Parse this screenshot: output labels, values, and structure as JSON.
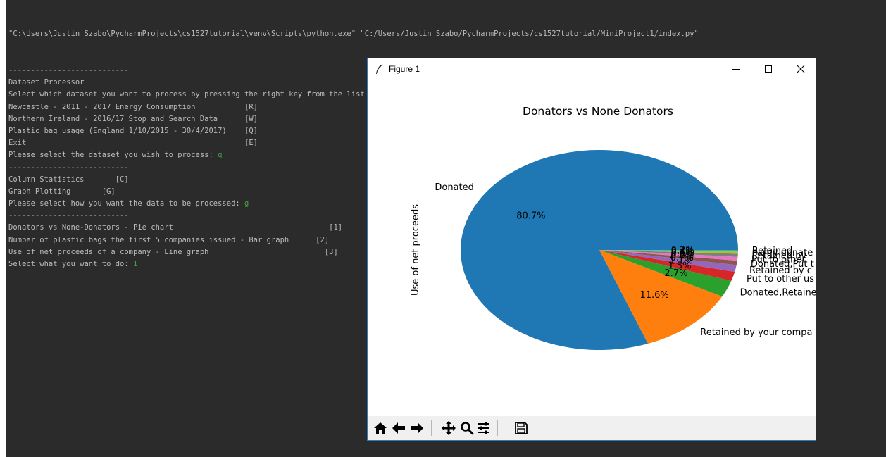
{
  "console": {
    "command_exe": "\"C:\\Users\\Justin Szabo\\PycharmProjects\\cs1527tutorial\\venv\\Scripts\\python.exe\"",
    "command_script": "\"C:/Users/Justin Szabo/PycharmProjects/cs1527tutorial/MiniProject1/index.py\"",
    "lines": [
      {
        "text": "---------------------------",
        "input": ""
      },
      {
        "text": "Dataset Processor",
        "input": ""
      },
      {
        "text": "Select which dataset you want to process by pressing the right key from the list below",
        "input": ""
      },
      {
        "text": "Newcastle - 2011 - 2017 Energy Consumption           [R]",
        "input": ""
      },
      {
        "text": "Northern Ireland - 2016/17 Stop and Search Data      [W]",
        "input": ""
      },
      {
        "text": "Plastic bag usage (England 1/10/2015 - 30/4/2017)    [Q]",
        "input": ""
      },
      {
        "text": "Exit                                                 [E]",
        "input": ""
      },
      {
        "text": "Please select the dataset you wish to process: ",
        "input": "q"
      },
      {
        "text": "---------------------------",
        "input": ""
      },
      {
        "text": "Column Statistics       [C]",
        "input": ""
      },
      {
        "text": "Graph Plotting       [G]",
        "input": ""
      },
      {
        "text": "Please select how you want the data to be processed: ",
        "input": "g"
      },
      {
        "text": "---------------------------",
        "input": ""
      },
      {
        "text": "Donators vs None-Donators - Pie chart                                   [1]",
        "input": ""
      },
      {
        "text": "Number of plastic bags the first 5 companies issued - Bar graph      [2]",
        "input": ""
      },
      {
        "text": "Use of net proceeds of a company - Line graph                          [3]",
        "input": ""
      },
      {
        "text": "Select what you want to do: ",
        "input": "1"
      }
    ]
  },
  "figure_window": {
    "title": "Figure 1",
    "icons": {
      "app": "feather-icon",
      "minimize": "minimize-icon",
      "maximize": "maximize-icon",
      "close": "close-icon"
    },
    "toolbar": [
      "home-icon",
      "back-arrow-icon",
      "forward-arrow-icon",
      "pan-icon",
      "zoom-icon",
      "subplots-icon",
      "save-icon"
    ]
  },
  "chart_data": {
    "type": "pie",
    "title": "Donators vs None Donators",
    "ylabel": "Use of net proceeds",
    "colors": [
      "#1f77b4",
      "#ff7f0e",
      "#2ca02c",
      "#d62728",
      "#9467bd",
      "#8c564b",
      "#e377c2",
      "#7f7f7f",
      "#bcbd22",
      "#17becf"
    ],
    "slices": [
      {
        "label": "Donated",
        "value": 80.7,
        "pct_label": "80.7%"
      },
      {
        "label": "Retained by your compa",
        "value": 11.6,
        "pct_label": "11.6%"
      },
      {
        "label": "Donated,Retaine",
        "value": 2.7,
        "pct_label": "2.7%"
      },
      {
        "label": "Put to other us",
        "value": 1.5,
        "pct_label": "1.5%"
      },
      {
        "label": "Retained by c",
        "value": 1.1,
        "pct_label": "1.1%"
      },
      {
        "label": "Donated,Put t",
        "value": 0.7,
        "pct_label": "0.7%"
      },
      {
        "label": "Put to other",
        "value": 0.6,
        "pct_label": "0.6%"
      },
      {
        "label": "Retained by",
        "value": 0.5,
        "pct_label": "0.5%"
      },
      {
        "label": "Partly donate",
        "value": 0.4,
        "pct_label": "0.4%"
      },
      {
        "label": "Retained",
        "value": 0.2,
        "pct_label": "0.2%"
      }
    ]
  }
}
